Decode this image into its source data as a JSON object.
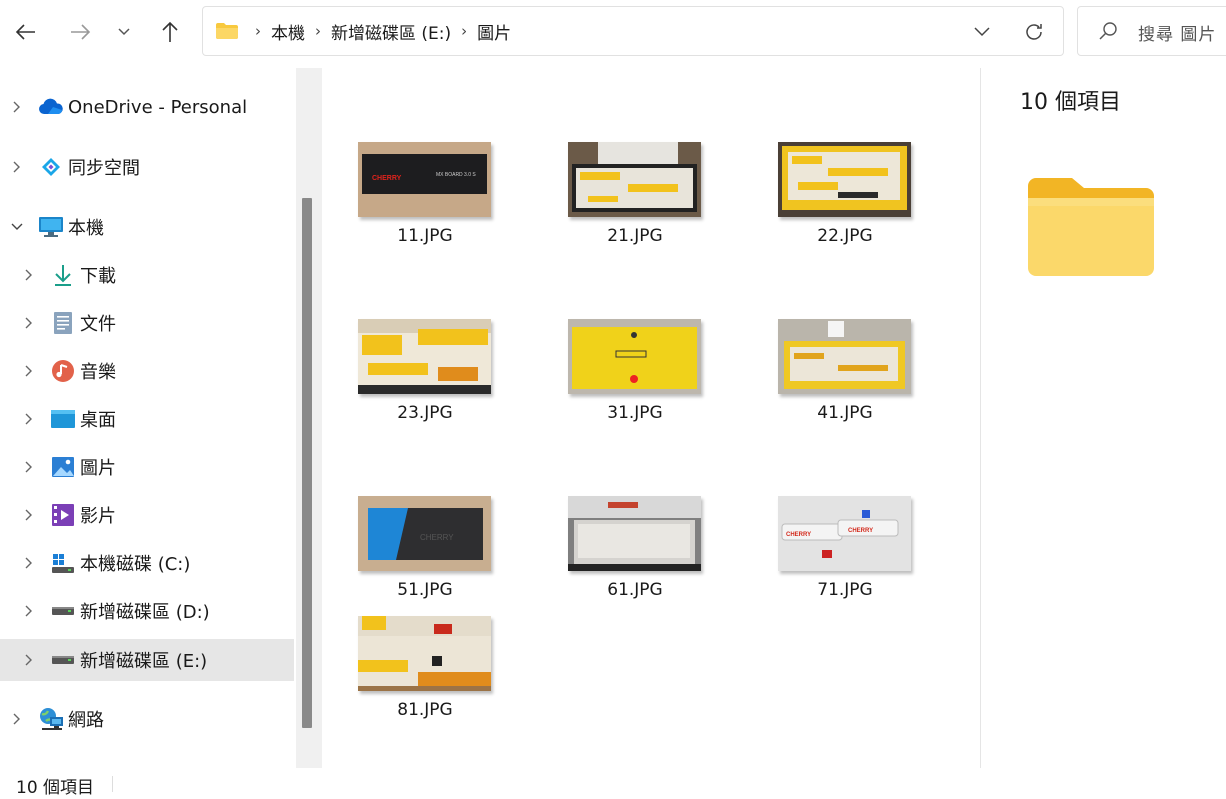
{
  "address": {
    "crumbs": [
      "本機",
      "新增磁碟區 (E:)",
      "圖片"
    ]
  },
  "search": {
    "placeholder": "搜尋 圖片"
  },
  "sidebar": {
    "items": [
      {
        "label": "OneDrive - Personal",
        "icon": "onedrive-cloud-icon",
        "expanded": false
      },
      {
        "label": "同步空間",
        "icon": "sync-space-icon",
        "expanded": false
      },
      {
        "label": "本機",
        "icon": "this-pc-icon",
        "expanded": true
      },
      {
        "label": "下載",
        "icon": "download-icon",
        "expanded": false
      },
      {
        "label": "文件",
        "icon": "documents-icon",
        "expanded": false
      },
      {
        "label": "音樂",
        "icon": "music-icon",
        "expanded": false
      },
      {
        "label": "桌面",
        "icon": "desktop-icon",
        "expanded": false
      },
      {
        "label": "圖片",
        "icon": "pictures-icon",
        "expanded": false
      },
      {
        "label": "影片",
        "icon": "videos-icon",
        "expanded": false
      },
      {
        "label": "本機磁碟 (C:)",
        "icon": "windows-drive-icon",
        "expanded": false
      },
      {
        "label": "新增磁碟區 (D:)",
        "icon": "drive-icon",
        "expanded": false
      },
      {
        "label": "新增磁碟區 (E:)",
        "icon": "drive-icon",
        "expanded": false,
        "selected": true
      },
      {
        "label": "網路",
        "icon": "network-icon",
        "expanded": false
      }
    ]
  },
  "files": [
    {
      "name": "11.JPG"
    },
    {
      "name": "21.JPG"
    },
    {
      "name": "22.JPG"
    },
    {
      "name": "23.JPG"
    },
    {
      "name": "31.JPG"
    },
    {
      "name": "41.JPG"
    },
    {
      "name": "51.JPG"
    },
    {
      "name": "61.JPG"
    },
    {
      "name": "71.JPG"
    },
    {
      "name": "81.JPG"
    }
  ],
  "details": {
    "count_text": "10 個項目"
  },
  "status": {
    "text": "10 個項目"
  },
  "colors": {
    "folder": "#f8c93e",
    "selected_bg": "#e6e6e6",
    "accent": "#0067c0"
  }
}
